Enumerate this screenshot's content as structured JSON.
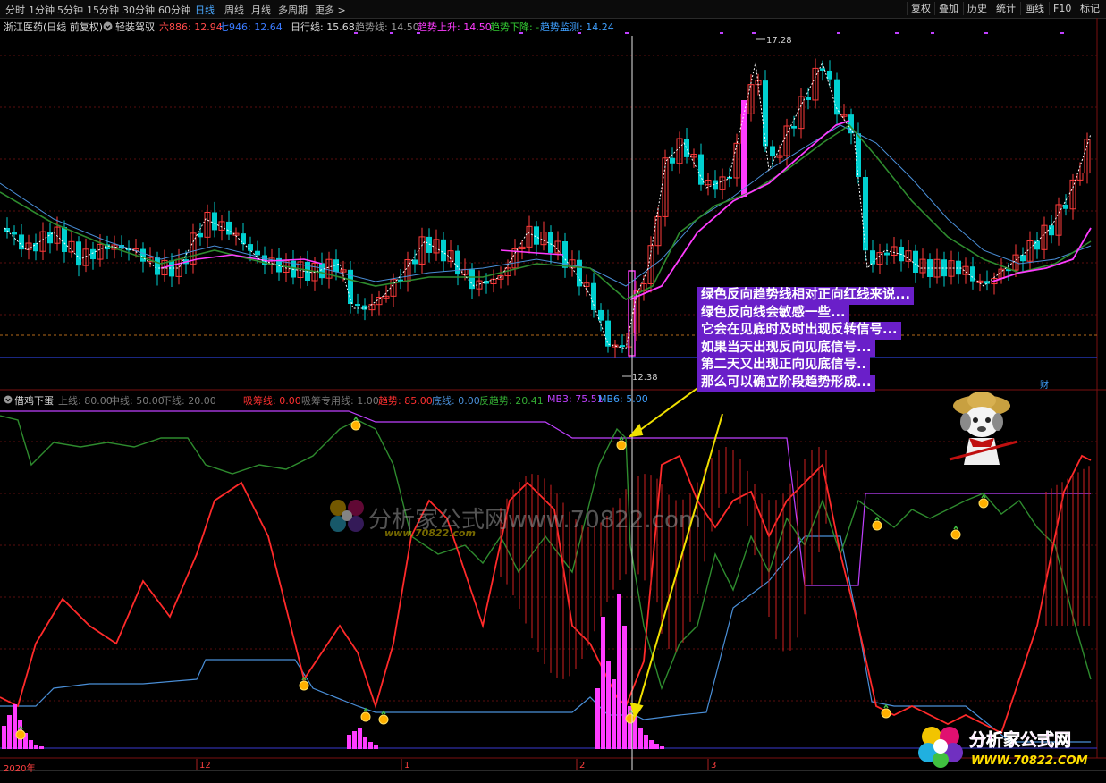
{
  "toolbar": {
    "periods": [
      "分时",
      "1分钟",
      "5分钟",
      "15分钟",
      "30分钟",
      "60分钟",
      "日线",
      "周线",
      "月线",
      "多周期",
      "更多 >"
    ],
    "active_period": "日线",
    "right_buttons": [
      "复权",
      "叠加",
      "历史",
      "统计",
      "画线",
      "F10",
      "标记"
    ]
  },
  "stock": {
    "name": "浙江医药(日线 前复权)",
    "indicator_label": "轻装驾驭",
    "ma6_label": "六886: 12.94",
    "ma7_label": "七946: 12.64",
    "day_line": "日行线: 15.68",
    "trend_line": "趋势线: 14.50",
    "trend_up": "趋势上升: 14.50",
    "trend_down": "趋势下降: -",
    "trend_monitor": "趋势监测: 14.24"
  },
  "price": {
    "high_label": "17.28",
    "low_label": "12.38",
    "cai_badge": "财"
  },
  "sub_indicator": {
    "name": "借鸡下蛋",
    "upper": "上线: 80.00",
    "middle": "中线: 50.00",
    "lower": "下线: 20.00",
    "xichou": "吸筹线: 0.00",
    "xichou_special": "吸筹专用线: 1.00",
    "trend": "趋势: 85.00",
    "bottom": "底线: 0.00",
    "reverse": "反趋势: 20.41",
    "mb3": "MB3: 75.51",
    "mb6": "MB6: 5.00"
  },
  "annotation": {
    "lines": [
      "绿色反向趋势线相对正向红线来说...",
      "绿色反向线会敏感一些...",
      "它会在见底时及时出现反转信号...",
      "如果当天出现反向见底信号...",
      "第二天又出现正向见底信号..",
      "那么可以确立阶段趋势形成..."
    ]
  },
  "watermark": {
    "center_text": "分析家公式网www.70822.com",
    "center_url": "www.70822.com",
    "logo_name": "分析家公式网",
    "logo_url": "WWW.70822.COM"
  },
  "time_axis": {
    "labels": [
      "2020年",
      "12",
      "1",
      "2",
      "3"
    ]
  },
  "colors": {
    "up": "#ff3b3b",
    "down": "#00d0d0",
    "magenta": "#ff3cff",
    "green": "#2e8b2e",
    "blue": "#4a8fd8",
    "red_line": "#ff2a2a",
    "violet_box": "#6a1fc9"
  },
  "icons": [
    "circle-collapse-icon",
    "doctor-mascot-icon",
    "flower-logo-icon",
    "gold-coin-icon"
  ]
}
